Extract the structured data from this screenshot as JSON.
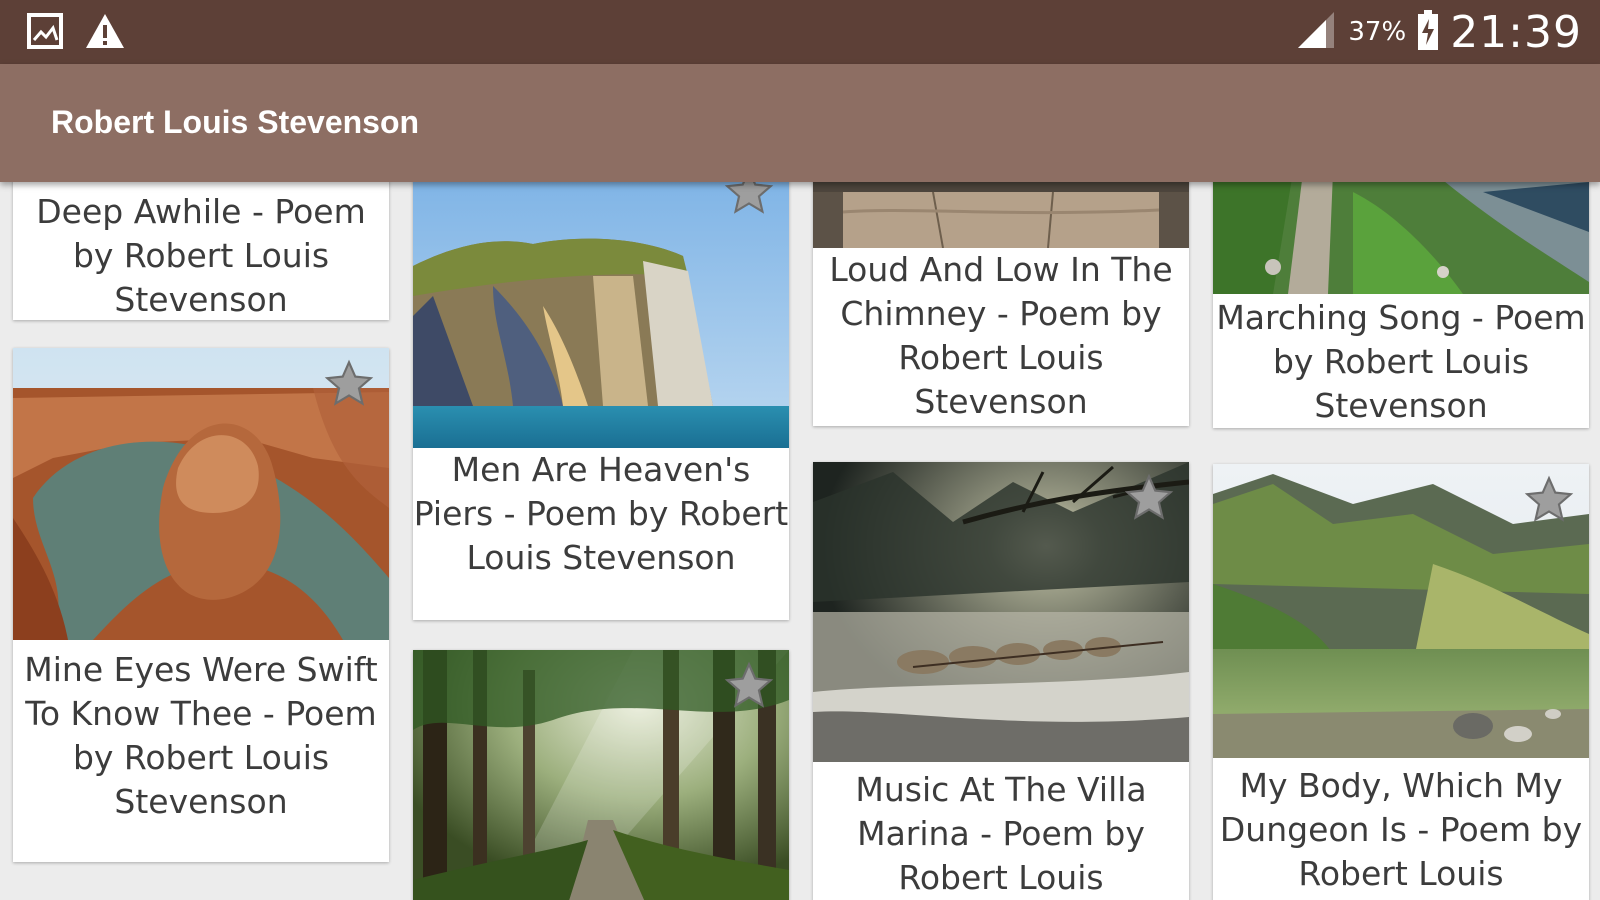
{
  "status_bar": {
    "icons": [
      "gallery-notification-icon",
      "warning-icon",
      "signal-icon",
      "battery-charging-icon"
    ],
    "battery_percent": "37%",
    "time": "21:39"
  },
  "app_bar": {
    "title": "Robert Louis Stevenson"
  },
  "colors": {
    "status_bar": "#5d4037",
    "app_bar": "#8d6e63",
    "star": "#9e9e9e"
  },
  "poems": [
    {
      "title": "Deep Awhile - Poem by Robert Louis Stevenson"
    },
    {
      "title": "Mine Eyes Were Swift To Know Thee - Poem by Robert Louis Stevenson",
      "image": "canyon river bend"
    },
    {
      "title": "Men Are Heaven's Piers - Poem by Robert Louis Stevenson",
      "image": "sea cliff"
    },
    {
      "title": "",
      "image": "forest road with sunbeams"
    },
    {
      "title": "Loud And Low In The Chimney - Poem by Robert Louis Stevenson",
      "image": "wooden table"
    },
    {
      "title": "Music At The Villa Marina - Poem by Robert Louis Stevenson",
      "image": "dog sled team in fog"
    },
    {
      "title": "Marching Song - Poem by Robert Louis Stevenson",
      "image": "mountain trail"
    },
    {
      "title": "My Body, Which My Dungeon Is - Poem by Robert Louis Stevenson",
      "image": "mountain lake"
    }
  ]
}
